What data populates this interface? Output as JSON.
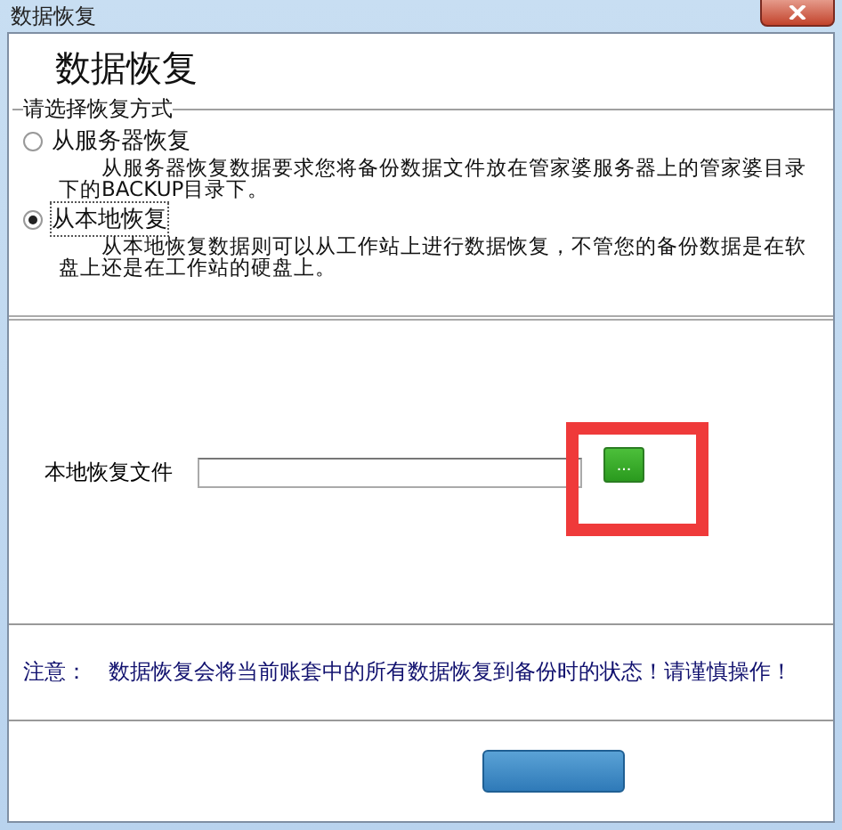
{
  "window": {
    "title": "数据恢复"
  },
  "heading": "数据恢复",
  "group": {
    "legend": "请选择恢复方式",
    "options": [
      {
        "label": "从服务器恢复",
        "selected": false,
        "description": "从服务器恢复数据要求您将备份数据文件放在管家婆服务器上的管家婆目录下的BACKUP目录下。"
      },
      {
        "label": "从本地恢复",
        "selected": true,
        "description": "从本地恢复数据则可以从工作站上进行数据恢复，不管您的备份数据是在软盘上还是在工作站的硬盘上。"
      }
    ]
  },
  "file": {
    "label": "本地恢复文件",
    "browse": "..."
  },
  "notice": {
    "label": "注意：",
    "text": "数据恢复会将当前账套中的所有数据恢复到备份时的状态！请谨慎操作！"
  }
}
